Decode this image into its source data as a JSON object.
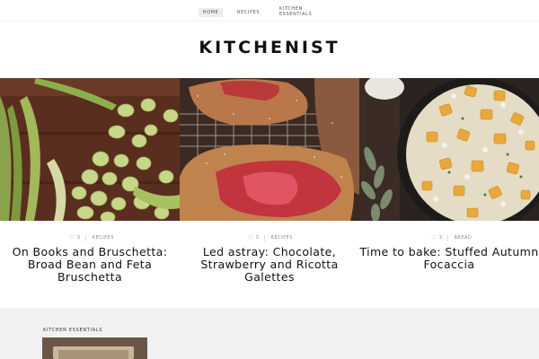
{
  "nav": {
    "items": [
      {
        "label": "HOME"
      },
      {
        "label": "RECIPES"
      },
      {
        "label": "KITCHEN ESSENTIALS"
      }
    ]
  },
  "logo": {
    "text": "KITCHENIST"
  },
  "posts": [
    {
      "likes": "3",
      "category": "RECIPES",
      "title": "On Books and Bruschetta: Broad Bean and Feta Bruschetta"
    },
    {
      "likes": "3",
      "category": "RECIPES",
      "title": "Led astray: Chocolate, Strawberry and Ricotta Galettes"
    },
    {
      "likes": "3",
      "category": "BREAD",
      "title": "Time to bake: Stuffed Autumn Focaccia"
    }
  ],
  "footer": {
    "section_label": "KITCHEN ESSENTIALS"
  },
  "colors": {
    "background": "#ffffff",
    "footer_band": "#f1f1f1",
    "active_nav": "#ededed"
  },
  "icons": {
    "like": "heart-icon"
  }
}
